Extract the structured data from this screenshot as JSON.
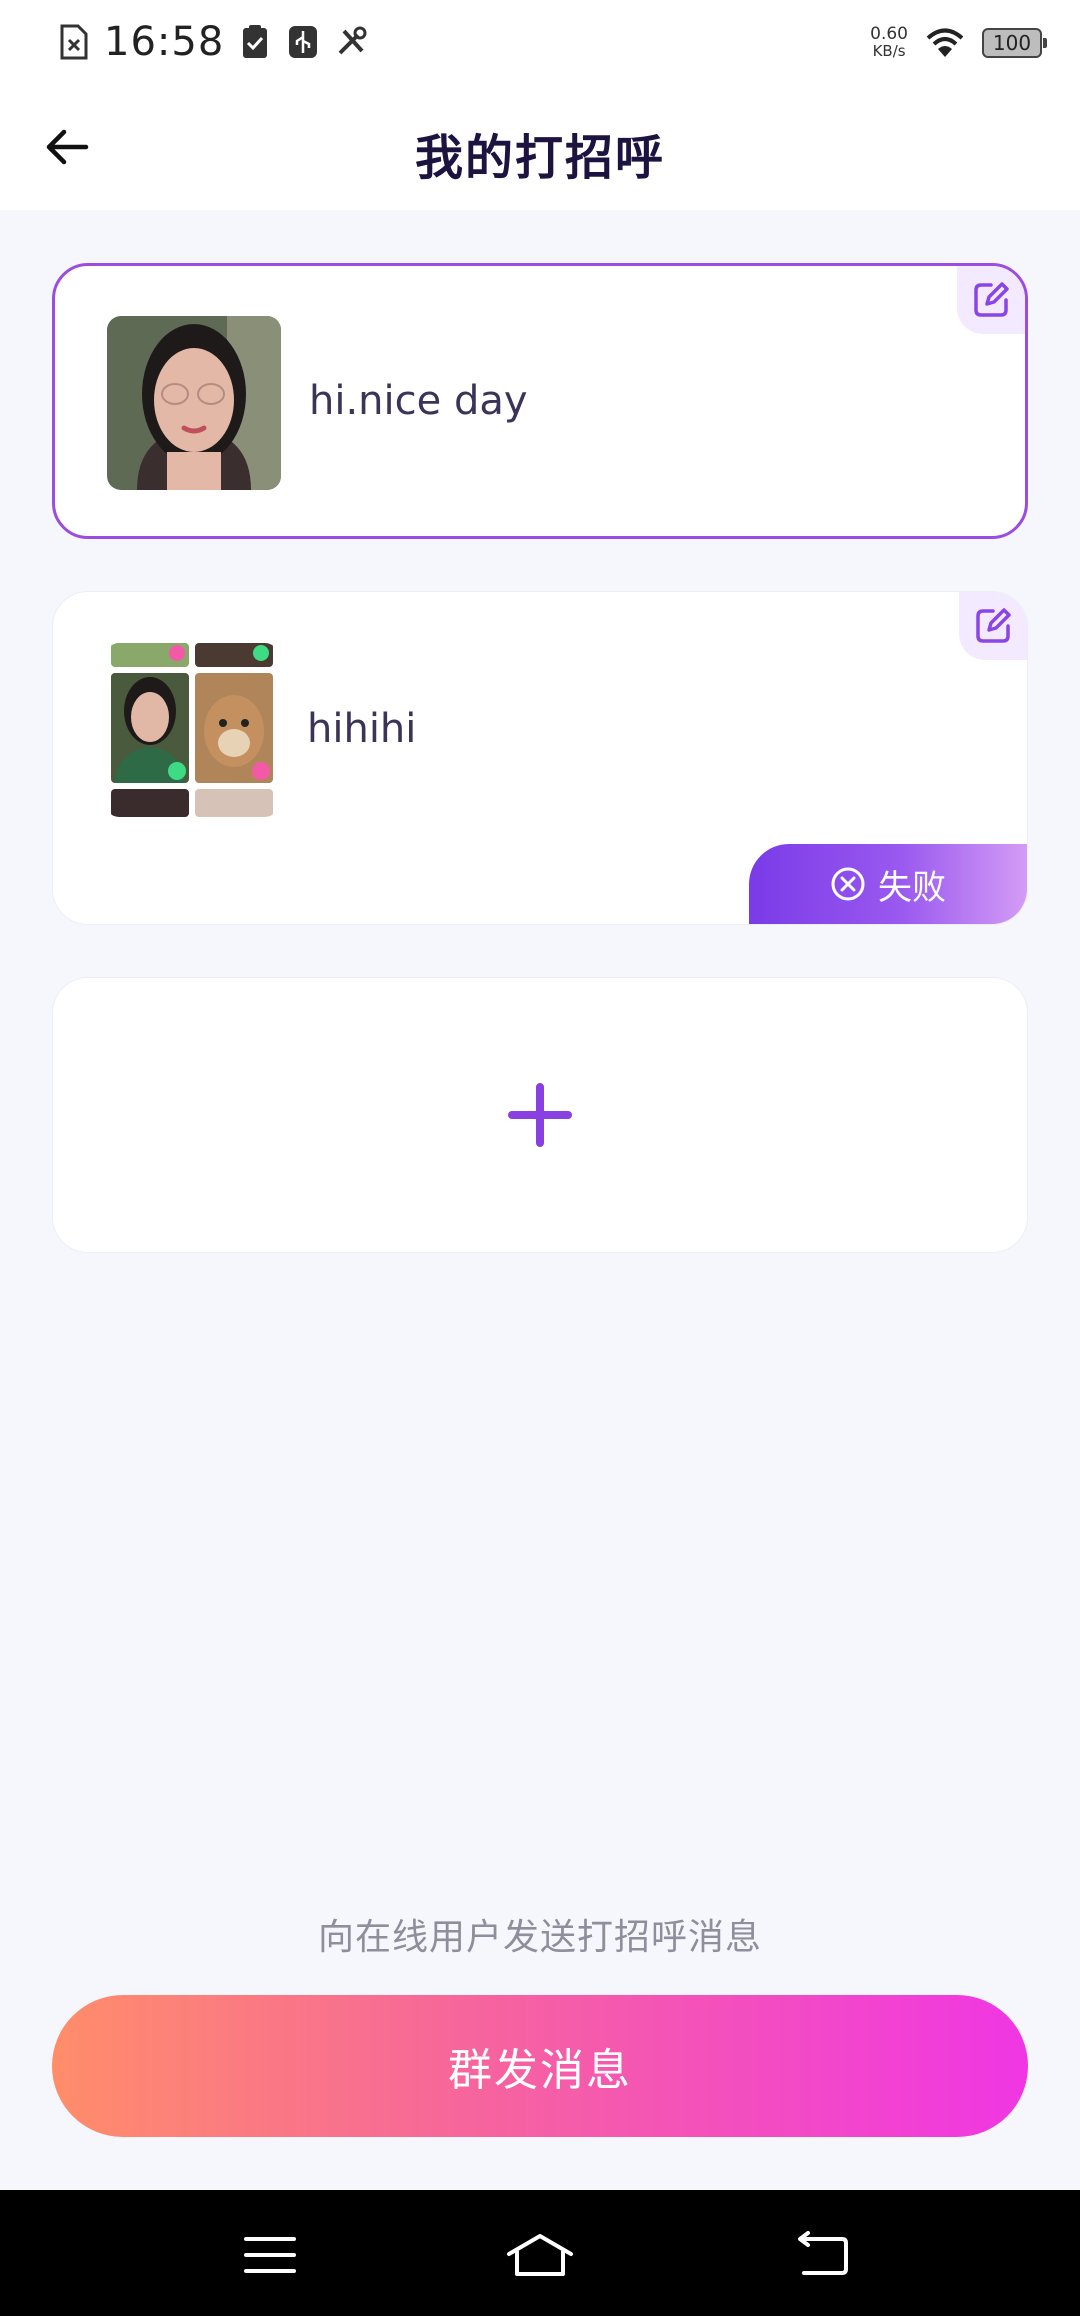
{
  "status_bar": {
    "time": "16:58",
    "icons_left": [
      "sim-error-icon",
      "clipboard-check-icon",
      "usb-debug-icon",
      "tools-icon"
    ],
    "net_speed": "0.60",
    "net_unit": "KB/s",
    "battery": "100"
  },
  "header": {
    "title": "我的打招呼",
    "back_icon": "arrow-left-icon"
  },
  "greetings": [
    {
      "text": "hi.nice day",
      "selected": true,
      "status": ""
    },
    {
      "text": "hihihi",
      "selected": false,
      "status": "失败"
    }
  ],
  "add_card": {
    "icon": "plus-icon"
  },
  "hint": "向在线用户发送打招呼消息",
  "group_send_button": {
    "label": "群发消息"
  },
  "colors": {
    "accent": "#9b4de0",
    "title": "#1d1340",
    "badge_start": "#7a3be8",
    "badge_end": "#d49cf6",
    "button_start": "#ff8d6a",
    "button_end": "#f036e4"
  },
  "nav_bar": {
    "icons": [
      "menu-icon",
      "home-icon",
      "back-icon"
    ]
  }
}
